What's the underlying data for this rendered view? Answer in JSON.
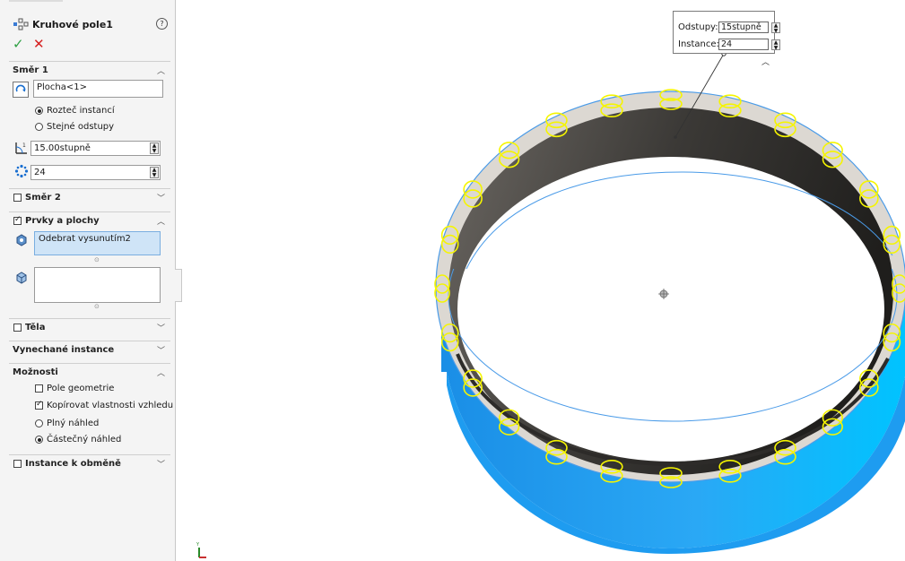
{
  "panel": {
    "title": "Kruhové pole1",
    "direction1": {
      "label": "Směr 1",
      "axis_value": "Plocha<1>",
      "opt_pitch": "Rozteč instancí",
      "opt_equal": "Stejné odstupy",
      "angle_value": "15.00stupně",
      "count_value": "24"
    },
    "direction2": {
      "label": "Směr 2"
    },
    "features": {
      "label": "Prvky a plochy",
      "selected_item": "Odebrat vysunutím2"
    },
    "bodies": {
      "label": "Těla"
    },
    "skipped": {
      "label": "Vynechané instance"
    },
    "options": {
      "label": "Možnosti",
      "geometry_pattern": "Pole geometrie",
      "copy_appearance": "Kopírovat vlastnosti vzhledu",
      "full_preview": "Plný náhled",
      "partial_preview": "Částečný náhled"
    },
    "instances_vary": {
      "label": "Instance k obměně"
    }
  },
  "callout": {
    "spacing_label": "Odstupy:",
    "spacing_value": "15stupně",
    "instances_label": "Instance:",
    "instances_value": "24"
  },
  "colors": {
    "ring_outer": "#1aa3f2",
    "ring_top": "#dcd8d2",
    "ring_inner": "#3f3d3a",
    "highlight": "#f5f500",
    "edge": "#4a9be8"
  }
}
